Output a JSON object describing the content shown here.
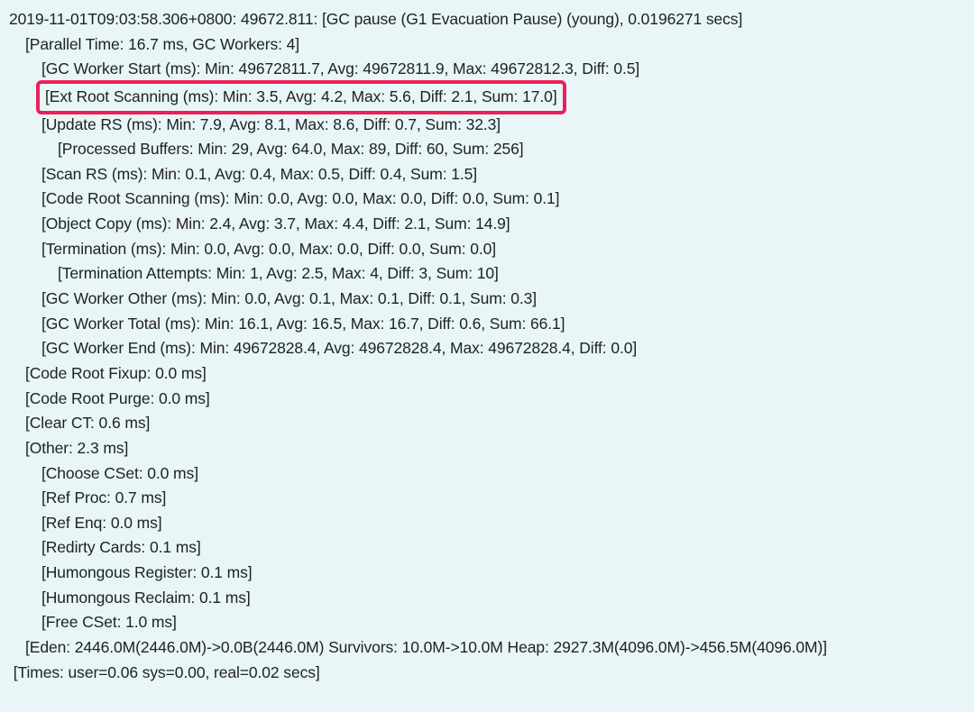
{
  "log": {
    "line0": "2019-11-01T09:03:58.306+0800: 49672.811: [GC pause (G1 Evacuation Pause) (young), 0.0196271 secs]",
    "line1": "[Parallel Time: 16.7 ms, GC Workers: 4]",
    "line2": "[GC Worker Start (ms): Min: 49672811.7, Avg: 49672811.9, Max: 49672812.3, Diff: 0.5]",
    "line3": "[Ext Root Scanning (ms): Min: 3.5, Avg: 4.2, Max: 5.6, Diff: 2.1, Sum: 17.0]",
    "line4": "[Update RS (ms): Min: 7.9, Avg: 8.1, Max: 8.6, Diff: 0.7, Sum: 32.3]",
    "line5": "[Processed Buffers: Min: 29, Avg: 64.0, Max: 89, Diff: 60, Sum: 256]",
    "line6": "[Scan RS (ms): Min: 0.1, Avg: 0.4, Max: 0.5, Diff: 0.4, Sum: 1.5]",
    "line7": "[Code Root Scanning (ms): Min: 0.0, Avg: 0.0, Max: 0.0, Diff: 0.0, Sum: 0.1]",
    "line8": "[Object Copy (ms): Min: 2.4, Avg: 3.7, Max: 4.4, Diff: 2.1, Sum: 14.9]",
    "line9": "[Termination (ms): Min: 0.0, Avg: 0.0, Max: 0.0, Diff: 0.0, Sum: 0.0]",
    "line10": "[Termination Attempts: Min: 1, Avg: 2.5, Max: 4, Diff: 3, Sum: 10]",
    "line11": "[GC Worker Other (ms): Min: 0.0, Avg: 0.1, Max: 0.1, Diff: 0.1, Sum: 0.3]",
    "line12": "[GC Worker Total (ms): Min: 16.1, Avg: 16.5, Max: 16.7, Diff: 0.6, Sum: 66.1]",
    "line13": "[GC Worker End (ms): Min: 49672828.4, Avg: 49672828.4, Max: 49672828.4, Diff: 0.0]",
    "line14": "[Code Root Fixup: 0.0 ms]",
    "line15": "[Code Root Purge: 0.0 ms]",
    "line16": "[Clear CT: 0.6 ms]",
    "line17": "[Other: 2.3 ms]",
    "line18": "[Choose CSet: 0.0 ms]",
    "line19": "[Ref Proc: 0.7 ms]",
    "line20": "[Ref Enq: 0.0 ms]",
    "line21": "[Redirty Cards: 0.1 ms]",
    "line22": "[Humongous Register: 0.1 ms]",
    "line23": "[Humongous Reclaim: 0.1 ms]",
    "line24": "[Free CSet: 1.0 ms]",
    "line25": "[Eden: 2446.0M(2446.0M)->0.0B(2446.0M) Survivors: 10.0M->10.0M Heap: 2927.3M(4096.0M)->456.5M(4096.0M)]",
    "line26": " [Times: user=0.06 sys=0.00, real=0.02 secs]"
  }
}
